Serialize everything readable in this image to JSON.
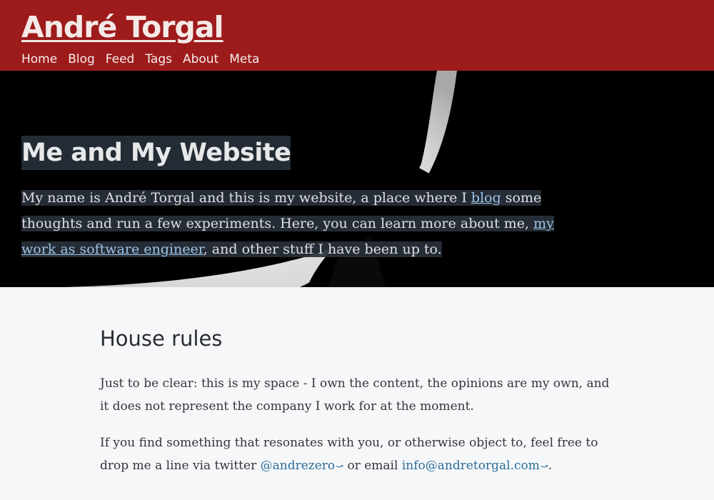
{
  "site": {
    "title": "André Torgal",
    "nav": [
      "Home",
      "Blog",
      "Feed",
      "Tags",
      "About",
      "Meta"
    ]
  },
  "hero": {
    "title": "Me and My Website",
    "text_1": "My name is André Torgal and this is my website, a place where I ",
    "link_blog": "blog",
    "text_2": " some thoughts and run a few experiments. Here, you can learn more about me, ",
    "link_work": "my work as software engineer",
    "text_3": ", and other stuff I have been up to."
  },
  "main": {
    "section_title": "House rules",
    "para1": "Just to be clear: this is my space - I own the content, the opinions are my own, and it does not represent the company I work for at the moment.",
    "para2_text_1": "If you find something that resonates with you, or otherwise object to, feel free to drop me a line via twitter ",
    "twitter_link": "@andrezero",
    "para2_text_2": " or email ",
    "email_link": "info@andretorgal.com",
    "para2_text_3": "."
  },
  "colors": {
    "header_bg": "#9e1b1c",
    "hero_bg": "#000000",
    "link": "#2b6d99",
    "hero_link": "#9dc4e8"
  },
  "icons": {
    "external_link": "external-link-icon"
  }
}
